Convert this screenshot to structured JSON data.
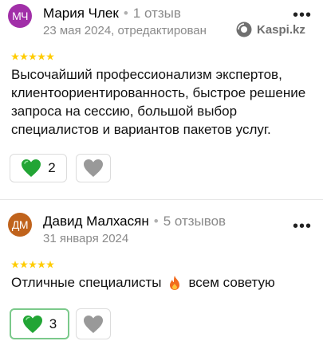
{
  "reviews": [
    {
      "initials": "МЧ",
      "avatar_color": "#a12fa8",
      "name": "Мария Члек",
      "reviews_count": "1 отзыв",
      "date": "23 мая 2024, отредактирован",
      "source": "Kaspi.kz",
      "rating": 5,
      "text": "Высочайший профессионализм экспертов, клиентоориентированность, быстрое решение запроса на сессию, большой выбор специалистов и вариантов пакетов услуг.",
      "likes": "2"
    },
    {
      "initials": "ДМ",
      "avatar_color": "#c0631c",
      "name": "Давид Малхасян",
      "reviews_count": "5 отзывов",
      "date": "31 января 2024",
      "rating": 5,
      "text_before": "Отличные специалисты",
      "text_after": "всем советую",
      "emoji": "fire-icon",
      "likes": "3"
    }
  ],
  "colors": {
    "star": "#ffcc00",
    "heart_green": "#22a535",
    "heart_gray": "#999999"
  }
}
